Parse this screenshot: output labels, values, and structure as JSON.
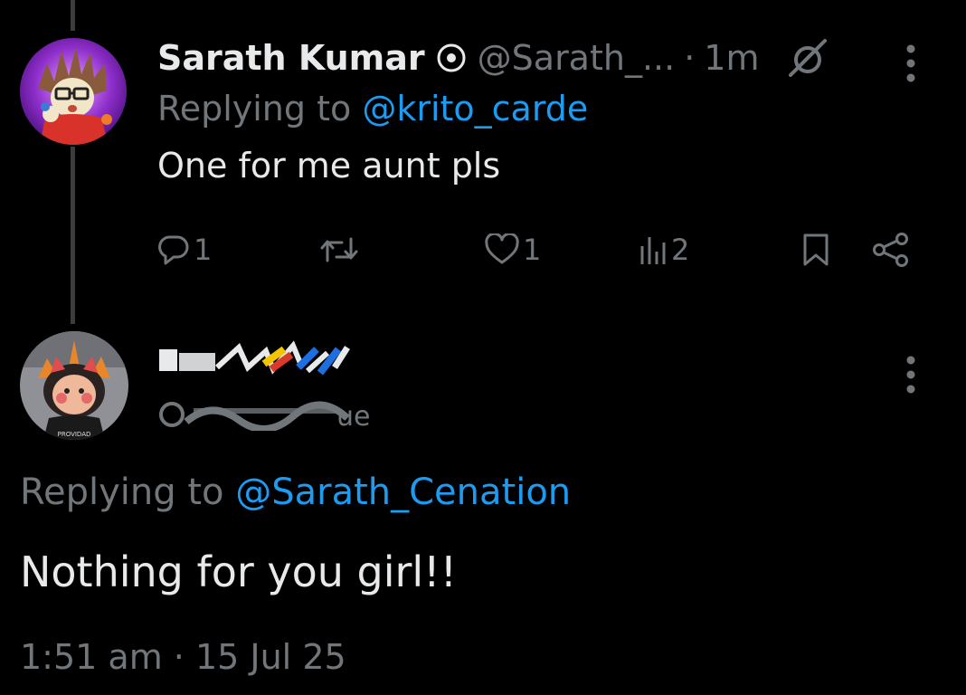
{
  "reply": {
    "author_name": "Sarath Kumar",
    "handle": "@Sarath_...",
    "separator": "·",
    "time": "1m",
    "replying_prefix": "Replying to ",
    "replying_to": "@krito_carde",
    "text": "One for me aunt pls",
    "actions": {
      "replies": "1",
      "retweets": "",
      "likes": "1",
      "views": "2"
    }
  },
  "main_tweet": {
    "author_name": "",
    "handle": "",
    "replying_prefix": "Replying to ",
    "replying_to": "@Sarath_Cenation",
    "text": "Nothing for you girl!!",
    "timestamp": "1:51 am · 15 Jul 25"
  },
  "avatar_text": "PROVIDAD",
  "icons": {
    "reply": "reply-icon",
    "retweet": "retweet-icon",
    "like": "like-icon",
    "views": "views-icon",
    "bookmark": "bookmark-icon",
    "share": "share-icon",
    "more": "more-icon",
    "verified": "verified-icon",
    "grok": "grok-icon"
  },
  "colors": {
    "background": "#000000",
    "primary_text": "#e7e9ea",
    "secondary_text": "#71767b",
    "link": "#1d9bf0",
    "thread_line": "#3a3c3e"
  }
}
